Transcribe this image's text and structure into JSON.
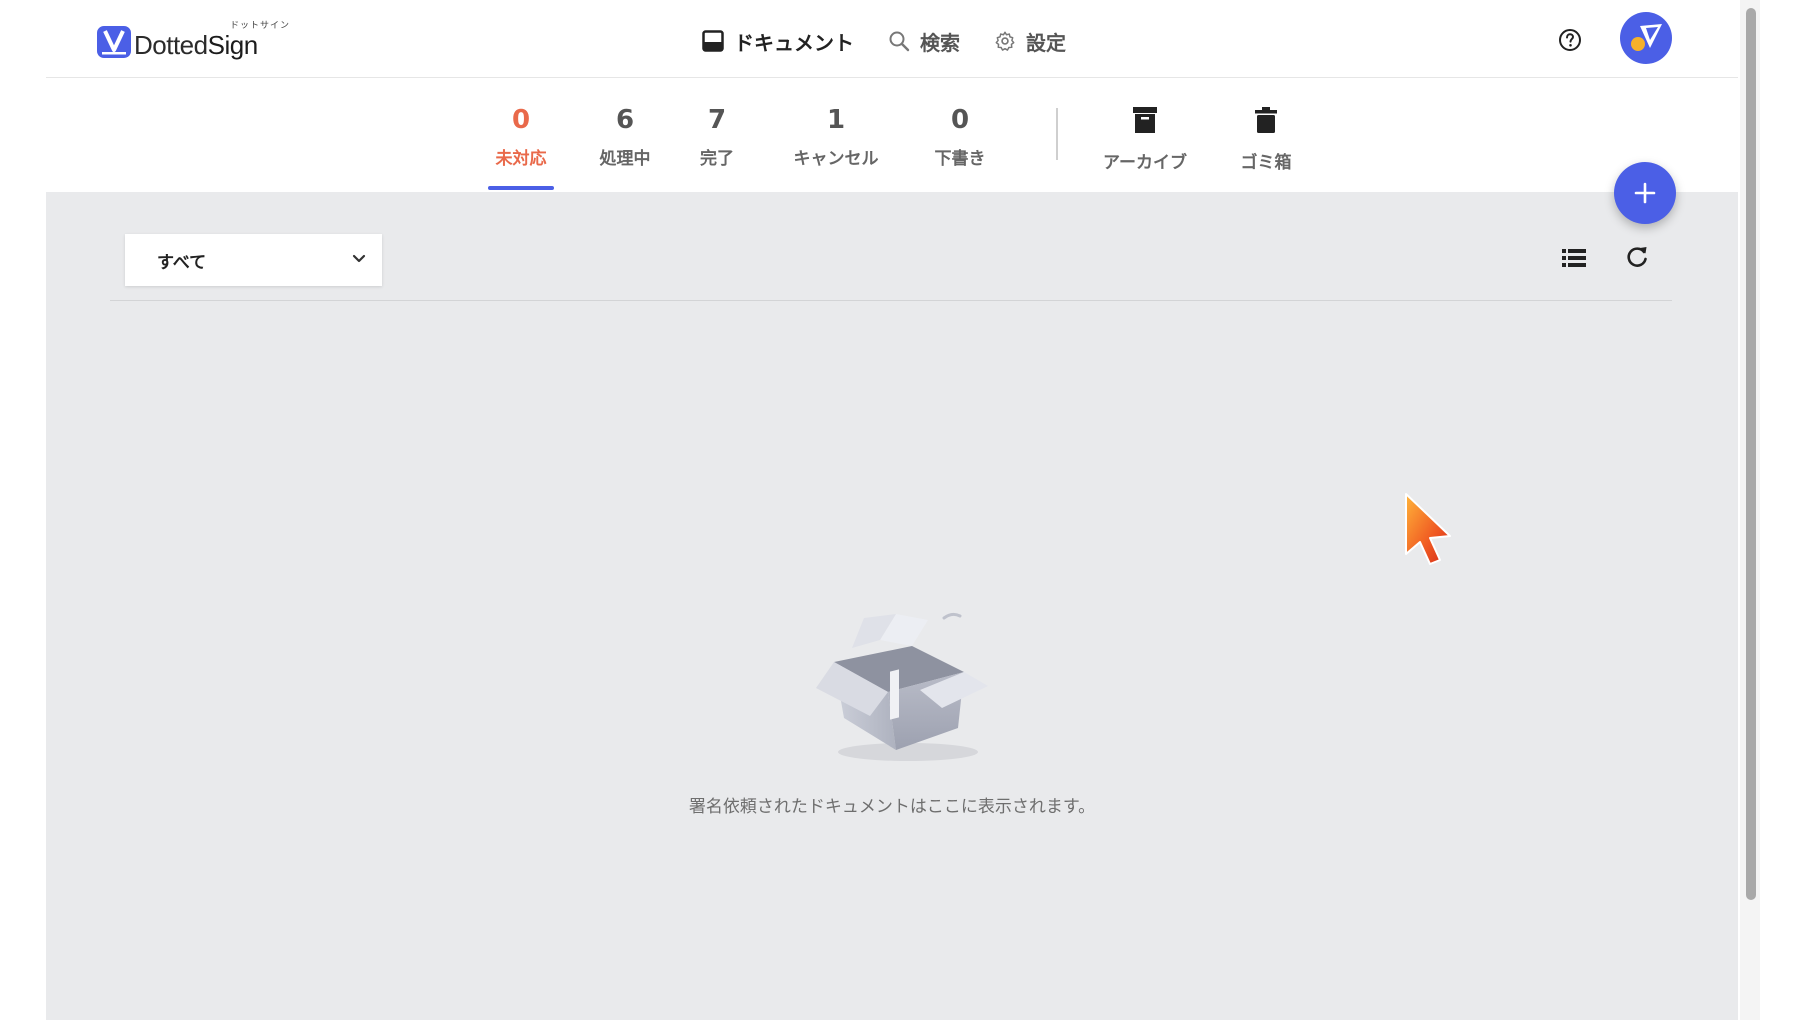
{
  "header": {
    "logo_text_main": "Dotted",
    "logo_text_sign": "Sign",
    "logo_kana": "ドットサイン",
    "nav": [
      {
        "label": "ドキュメント",
        "icon": "inbox-icon"
      },
      {
        "label": "検索",
        "icon": "search-icon"
      },
      {
        "label": "設定",
        "icon": "gear-icon"
      }
    ],
    "help_icon": "question-circle-icon",
    "avatar_icon": "avatar"
  },
  "tabs": [
    {
      "count": "0",
      "label": "未対応"
    },
    {
      "count": "6",
      "label": "処理中"
    },
    {
      "count": "7",
      "label": "完了"
    },
    {
      "count": "1",
      "label": "キャンセル"
    },
    {
      "count": "0",
      "label": "下書き"
    },
    {
      "label": "アーカイブ",
      "icon": "archive-box-icon"
    },
    {
      "label": "ゴミ箱",
      "icon": "trash-icon"
    }
  ],
  "toolbar": {
    "filter_value": "すべて",
    "list_view_icon": "list-view-icon",
    "refresh_icon": "refresh-icon"
  },
  "empty_state": {
    "message": "署名依頼されたドキュメントはここに表示されます。"
  },
  "colors": {
    "accent": "#4b5fe6",
    "active_tab": "#e9694a",
    "content_bg": "#e9eaec"
  }
}
